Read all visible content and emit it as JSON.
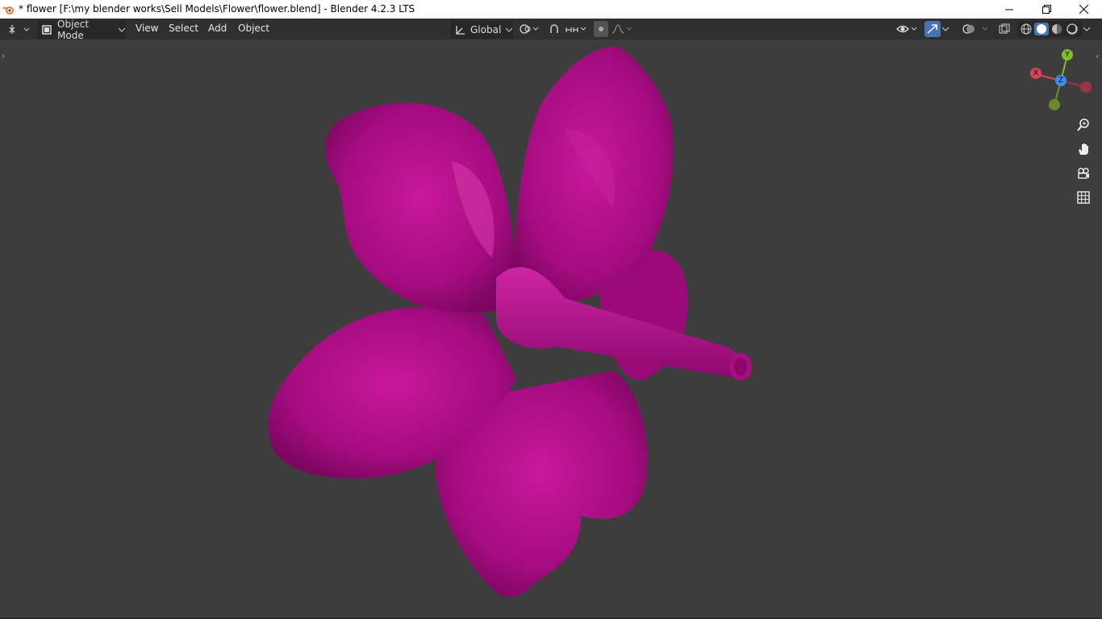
{
  "window": {
    "title": "* flower [F:\\my blender works\\Sell Models\\Flower\\flower.blend] - Blender 4.2.3 LTS"
  },
  "header": {
    "mode_label": "Object Mode",
    "menus": [
      "View",
      "Select",
      "Add",
      "Object"
    ],
    "transform_orientation": "Global"
  },
  "gizmo": {
    "x_label": "X",
    "y_label": "Y",
    "z_label": "Z"
  },
  "colors": {
    "viewport_bg": "#3d3d3d",
    "flower": "#b00f8a",
    "gizmo_x": "#d8455a",
    "gizmo_y": "#7fbf2a",
    "gizmo_z": "#3b8ee8",
    "header_active": "#4772b3"
  },
  "icons": [
    "blender-logo-icon",
    "minimize-icon",
    "restore-icon",
    "close-icon",
    "editor-type-icon",
    "object-mode-icon",
    "orientation-icon",
    "pivot-icon",
    "snap-icon",
    "snap-target-icon",
    "proportional-edit-icon",
    "falloff-icon",
    "visibility-icon",
    "gizmo-icon",
    "overlay-icon",
    "xray-icon",
    "wireframe-shading-icon",
    "solid-shading-icon",
    "material-shading-icon",
    "rendered-shading-icon",
    "zoom-icon",
    "pan-hand-icon",
    "camera-view-icon",
    "ortho-grid-icon"
  ]
}
